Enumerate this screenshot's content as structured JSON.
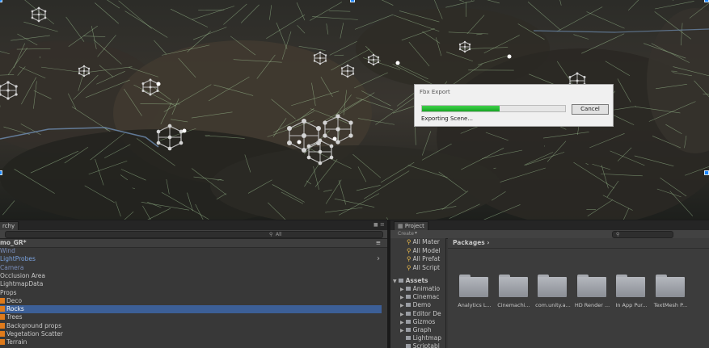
{
  "dialog": {
    "title": "Fbx Export",
    "cancel_label": "Cancel",
    "status": "Exporting Scene...",
    "progress": 0.54
  },
  "hierarchy": {
    "tab_label": "rchy",
    "search_placeholder": "All",
    "scene_name": "mo_GR*",
    "items": [
      {
        "label": "Wind",
        "has_icon": false,
        "color": "#7a8db8",
        "selected": false,
        "arrow": false
      },
      {
        "label": "LightProbes",
        "has_icon": false,
        "color": "#7aa3e0",
        "selected": false,
        "arrow": true
      },
      {
        "label": "Camera",
        "has_icon": false,
        "color": "#7a8db8",
        "selected": false,
        "arrow": false
      },
      {
        "label": "Occlusion Area",
        "has_icon": false,
        "color": "#c8c8c8",
        "selected": false,
        "arrow": false
      },
      {
        "label": "LightmapData",
        "has_icon": false,
        "color": "#c8c8c8",
        "selected": false,
        "arrow": false
      },
      {
        "label": "Props",
        "has_icon": false,
        "color": "#c8c8c8",
        "selected": false,
        "arrow": false
      },
      {
        "label": "Deco",
        "has_icon": true,
        "color": "#c8c8c8",
        "selected": false,
        "arrow": false
      },
      {
        "label": "Rocks",
        "has_icon": true,
        "color": "#ffffff",
        "selected": true,
        "arrow": false
      },
      {
        "label": "Trees",
        "has_icon": true,
        "color": "#c8c8c8",
        "selected": false,
        "arrow": false
      },
      {
        "label": "Background props",
        "has_icon": true,
        "color": "#c8c8c8",
        "selected": false,
        "arrow": false
      },
      {
        "label": "Vegetation Scatter",
        "has_icon": true,
        "color": "#c8c8c8",
        "selected": false,
        "arrow": false
      },
      {
        "label": "Terrain",
        "has_icon": true,
        "color": "#c8c8c8",
        "selected": false,
        "arrow": false
      }
    ]
  },
  "project": {
    "tab_label": "Project",
    "create_label": "Create",
    "breadcrumb": "Packages",
    "favorites": [
      "All Mater",
      "All Model",
      "All Prefat",
      "All Script"
    ],
    "assets_label": "Assets",
    "assets_children": [
      "Animatio",
      "Cinemac",
      "Demo",
      "Editor De",
      "Gizmos",
      "Graph",
      "Lightmap",
      "Scriptabl"
    ],
    "packages": [
      "Analytics L...",
      "Cinemachi...",
      "com.unity.a...",
      "HD Render ...",
      "In App Pur...",
      "TextMesh P..."
    ]
  }
}
